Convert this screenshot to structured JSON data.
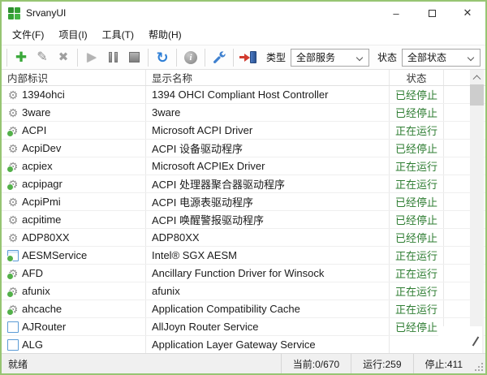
{
  "window": {
    "title": "SrvanyUI",
    "controls": {
      "minimize": "–",
      "close": "✕"
    }
  },
  "menu": {
    "items": [
      {
        "label": "文件(F)"
      },
      {
        "label": "项目(I)"
      },
      {
        "label": "工具(T)"
      },
      {
        "label": "帮助(H)"
      }
    ]
  },
  "toolbar": {
    "icons": [
      "add-icon",
      "edit-icon",
      "delete-icon",
      "start-icon",
      "pause-icon",
      "stop-icon",
      "refresh-icon",
      "info-icon",
      "wrench-icon",
      "exit-icon"
    ],
    "type_label": "类型",
    "type_value": "全部服务",
    "state_label": "状态",
    "state_value": "全部状态"
  },
  "table": {
    "columns": [
      "内部标识",
      "显示名称",
      "状态"
    ],
    "rows": [
      {
        "icon": "gear-stopped",
        "id": "1394ohci",
        "name": "1394 OHCI Compliant Host Controller",
        "status": "已经停止"
      },
      {
        "icon": "gear-stopped",
        "id": "3ware",
        "name": "3ware",
        "status": "已经停止"
      },
      {
        "icon": "gear-running",
        "id": "ACPI",
        "name": "Microsoft ACPI Driver",
        "status": "正在运行"
      },
      {
        "icon": "gear-stopped",
        "id": "AcpiDev",
        "name": "ACPI 设备驱动程序",
        "status": "已经停止"
      },
      {
        "icon": "gear-running",
        "id": "acpiex",
        "name": "Microsoft ACPIEx Driver",
        "status": "正在运行"
      },
      {
        "icon": "gear-running",
        "id": "acpipagr",
        "name": "ACPI 处理器聚合器驱动程序",
        "status": "正在运行"
      },
      {
        "icon": "gear-stopped",
        "id": "AcpiPmi",
        "name": "ACPI 电源表驱动程序",
        "status": "已经停止"
      },
      {
        "icon": "gear-stopped",
        "id": "acpitime",
        "name": "ACPI 唤醒警报驱动程序",
        "status": "已经停止"
      },
      {
        "icon": "gear-stopped",
        "id": "ADP80XX",
        "name": "ADP80XX",
        "status": "已经停止"
      },
      {
        "icon": "app-running",
        "id": "AESMService",
        "name": "Intel® SGX AESM",
        "status": "正在运行"
      },
      {
        "icon": "gear-running",
        "id": "AFD",
        "name": "Ancillary Function Driver for Winsock",
        "status": "正在运行"
      },
      {
        "icon": "gear-running",
        "id": "afunix",
        "name": "afunix",
        "status": "正在运行"
      },
      {
        "icon": "gear-running",
        "id": "ahcache",
        "name": "Application Compatibility Cache",
        "status": "正在运行"
      },
      {
        "icon": "window",
        "id": "AJRouter",
        "name": "AllJoyn Router Service",
        "status": "已经停止"
      },
      {
        "icon": "window",
        "id": "ALG",
        "name": "Application Layer Gateway Service",
        "status": ""
      }
    ]
  },
  "statusbar": {
    "ready": "就绪",
    "current": "当前:0/670",
    "running": "运行:259",
    "stopped": "停止:411"
  },
  "colors": {
    "window_border": "#97c573",
    "status_text": "#2e7d32",
    "accent_green": "#35a235",
    "accent_blue": "#2f7fd6",
    "accent_red": "#d23b2f"
  }
}
